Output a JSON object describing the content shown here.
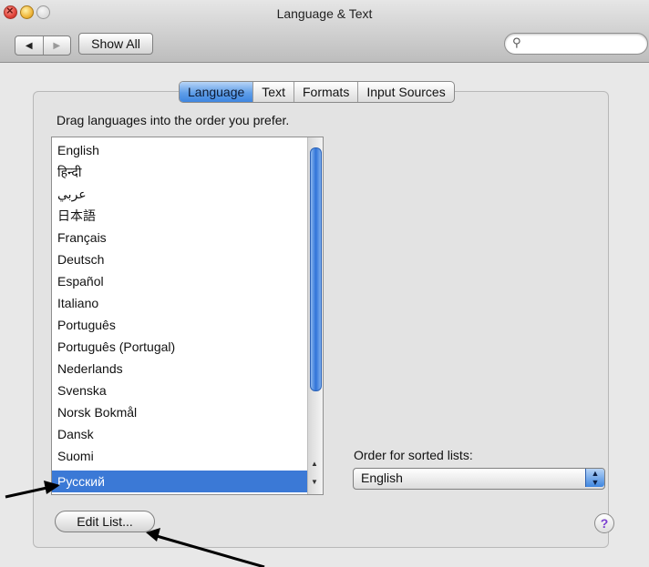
{
  "window": {
    "title": "Language & Text"
  },
  "toolbar": {
    "back_icon": "back-arrow-icon",
    "forward_icon": "forward-arrow-icon",
    "show_all_label": "Show All",
    "search_icon": "magnifier-icon",
    "search_value": ""
  },
  "tabs": [
    {
      "label": "Language",
      "active": true
    },
    {
      "label": "Text",
      "active": false
    },
    {
      "label": "Formats",
      "active": false
    },
    {
      "label": "Input Sources",
      "active": false
    }
  ],
  "language_pane": {
    "instruction": "Drag languages into the order you prefer.",
    "languages": [
      "English",
      "हिन्दी",
      "عربي",
      "日本語",
      "Français",
      "Deutsch",
      "Español",
      "Italiano",
      "Português",
      "Português (Portugal)",
      "Nederlands",
      "Svenska",
      "Norsk Bokmål",
      "Dansk",
      "Suomi",
      "Русский"
    ],
    "selected_language": "Русский",
    "sorted_lists_label": "Order for sorted lists:",
    "sorted_lists_value": "English",
    "edit_list_label": "Edit List...",
    "help_label": "?"
  },
  "colors": {
    "selection": "#3b79d6",
    "tab_active": "#5f9ee8",
    "help_mark": "#7b3fd0"
  }
}
